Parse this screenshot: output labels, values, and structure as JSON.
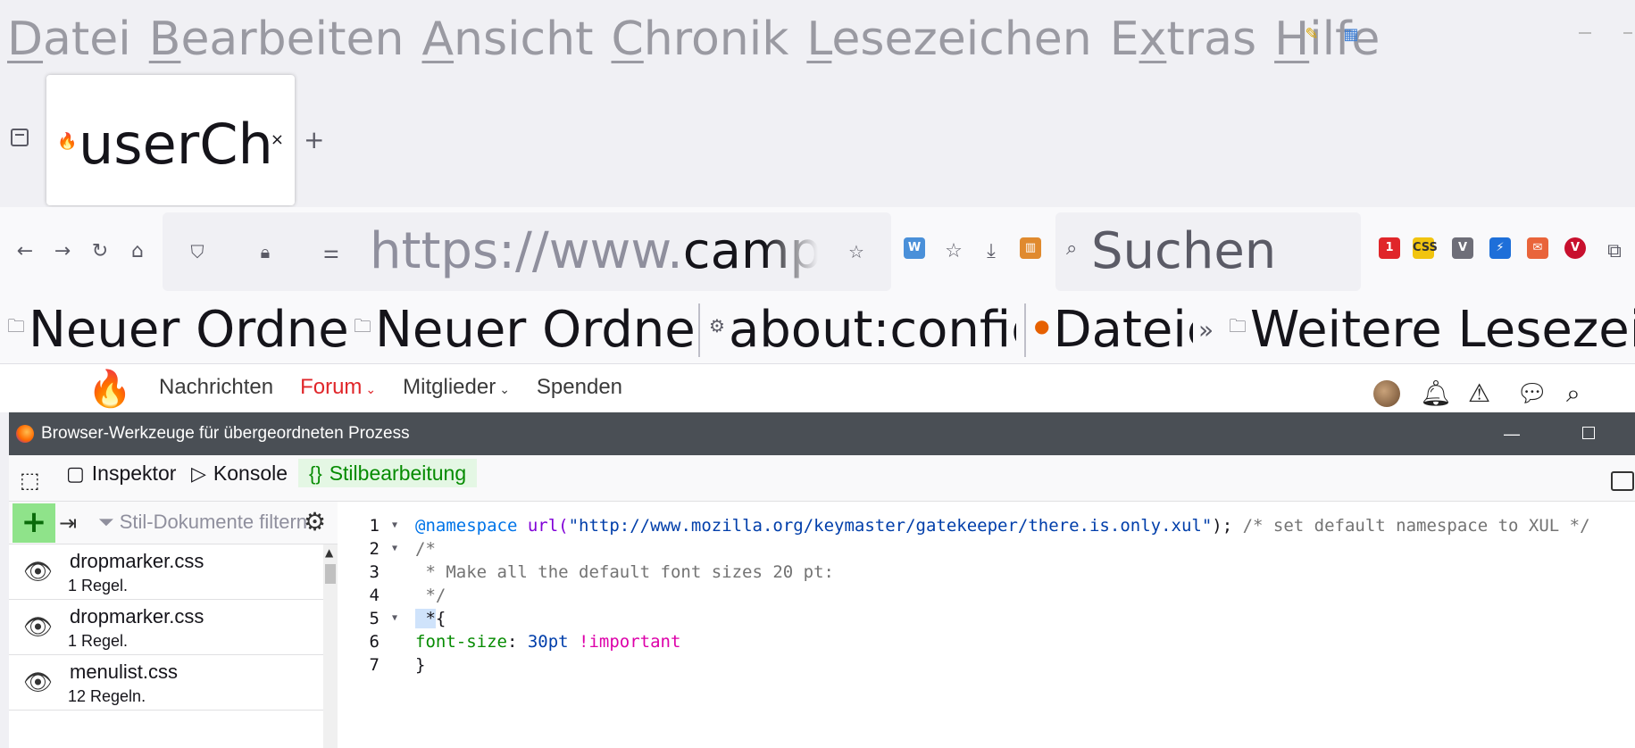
{
  "menubar": {
    "items": [
      {
        "accesskey": "D",
        "rest": "atei"
      },
      {
        "accesskey": "B",
        "rest": "earbeiten"
      },
      {
        "accesskey": "A",
        "rest": "nsicht"
      },
      {
        "accesskey": "C",
        "rest": "hronik"
      },
      {
        "accesskey": "L",
        "rest": "esezeichen"
      },
      {
        "pre": "E",
        "accesskey": "x",
        "rest": "tras"
      },
      {
        "accesskey": "H",
        "rest": "ilfe"
      }
    ],
    "extension_icons": [
      "notepad-icon",
      "calendar-icon"
    ]
  },
  "tabs": {
    "active_title": "userChrome.css",
    "close": "×",
    "new_tab": "+"
  },
  "navbar": {
    "url_prefix": "https://www.",
    "url_domain": "camp-firefox.de",
    "search_placeholder": "Suchen",
    "badge_count": "1"
  },
  "bookmarks": {
    "items": [
      {
        "label": "Neuer Ordner",
        "icon": "folder-icon"
      },
      {
        "label": "Neuer Ordner",
        "icon": "folder-icon"
      },
      {
        "label": "about:config",
        "icon": "gear-icon"
      },
      {
        "label": "Dateien",
        "icon": "firefox-icon"
      },
      {
        "label": "Weitere Lesezeichen",
        "icon": "folder-icon"
      }
    ],
    "overflow": "»"
  },
  "site": {
    "nav": [
      "Nachrichten",
      "Forum",
      "Mitglieder",
      "Spenden"
    ],
    "active": "Forum"
  },
  "devtools": {
    "window_title": "Browser-Werkzeuge für übergeordneten Prozess",
    "tabs": [
      "Inspektor",
      "Konsole",
      "Stilbearbeitung"
    ],
    "selected_tab": "Stilbearbeitung",
    "filter_placeholder": "Stil-Dokumente filtern",
    "sheets": [
      {
        "name": "dropmarker.css",
        "rules": "1 Regel."
      },
      {
        "name": "dropmarker.css",
        "rules": "1 Regel."
      },
      {
        "name": "menulist.css",
        "rules": "12 Regeln."
      }
    ],
    "code_lines": [
      "1",
      "2",
      "3",
      "4",
      "5",
      "6",
      "7"
    ],
    "code": {
      "l1_at": "@namespace",
      "l1_fn": "url(",
      "l1_str": "\"http://www.mozilla.org/keymaster/gatekeeper/there.is.only.xul\"",
      "l1_close": ");",
      "l1_comment": " /* set default namespace to XUL */",
      "l2": "/*",
      "l3": " * Make all the default font sizes 20 pt:",
      "l4": " */",
      "l5_sel": " *",
      "l5_rest": "{",
      "l6_prop": "font-size",
      "l6_colon": ": ",
      "l6_num": "30pt",
      "l6_imp": " !important",
      "l7": "}"
    }
  },
  "colors": {
    "accent_red": "#e0262a",
    "devtools_green": "#058b00",
    "devtools_titlebar": "#4a4f55"
  }
}
